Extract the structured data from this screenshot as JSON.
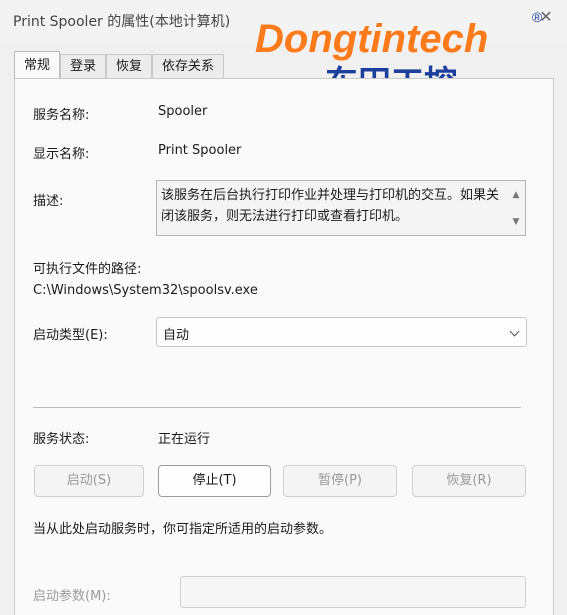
{
  "window": {
    "title": "Print Spooler 的属性(本地计算机)",
    "close_glyph": "✕"
  },
  "watermark": {
    "brand": "Dongtintech",
    "chinese": "东田工控",
    "registered": "®"
  },
  "tabs": [
    {
      "label": "常规",
      "active": true
    },
    {
      "label": "登录",
      "active": false
    },
    {
      "label": "恢复",
      "active": false
    },
    {
      "label": "依存关系",
      "active": false
    }
  ],
  "general": {
    "service_name_label": "服务名称:",
    "service_name_value": "Spooler",
    "display_name_label": "显示名称:",
    "display_name_value": "Print Spooler",
    "description_label": "描述:",
    "description_value": "该服务在后台执行打印作业并处理与打印机的交互。如果关闭该服务，则无法进行打印或查看打印机。",
    "exe_path_label": "可执行文件的路径:",
    "exe_path_value": "C:\\Windows\\System32\\spoolsv.exe",
    "startup_type_label": "启动类型(E):",
    "startup_type_value": "自动",
    "status_label": "服务状态:",
    "status_value": "正在运行",
    "buttons": {
      "start": "启动(S)",
      "stop": "停止(T)",
      "pause": "暂停(P)",
      "resume": "恢复(R)"
    },
    "hint": "当从此处启动服务时，你可指定所适用的启动参数。",
    "start_params_label": "启动参数(M):",
    "start_params_value": ""
  }
}
